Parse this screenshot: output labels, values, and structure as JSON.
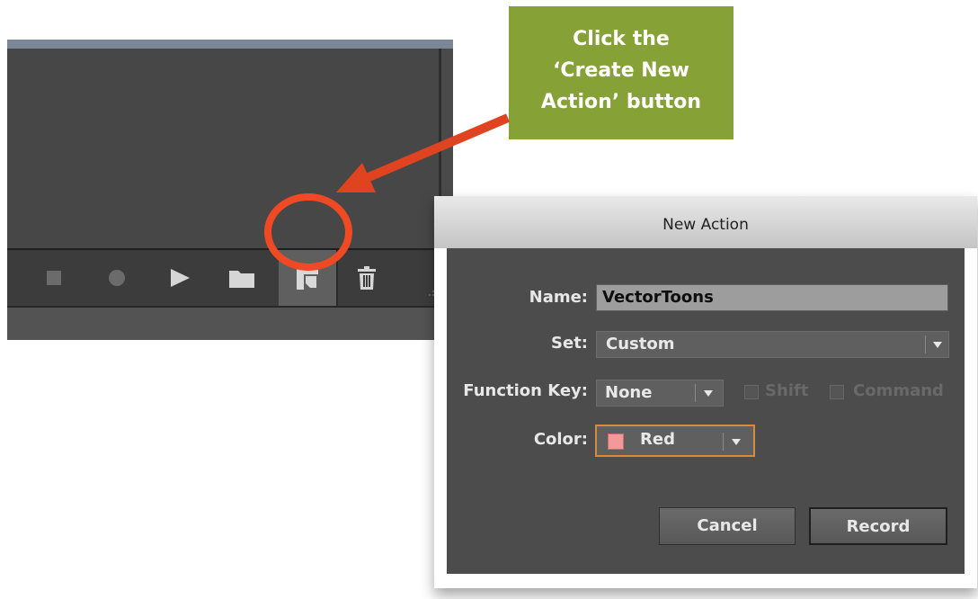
{
  "callout": {
    "lines": [
      "Click the",
      "‘Create New",
      "Action’ button"
    ],
    "background": "#86a135"
  },
  "annotation": {
    "arrow_color": "#e0431f",
    "highlight_circle_color": "#ef4a24"
  },
  "actions_panel": {
    "toolbar_icons": [
      "stop-icon",
      "record-icon",
      "play-icon",
      "folder-icon",
      "new-action-icon",
      "trash-icon"
    ]
  },
  "dialog": {
    "title": "New Action",
    "name_label": "Name:",
    "name_value": "VectorToons",
    "set_label": "Set:",
    "set_value": "Custom",
    "function_key_label": "Function Key:",
    "function_key_value": "None",
    "shift_label": "Shift",
    "command_label": "Command",
    "color_label": "Color:",
    "color_value": "Red",
    "color_swatch": "#f29a9a",
    "cancel_label": "Cancel",
    "record_label": "Record"
  }
}
